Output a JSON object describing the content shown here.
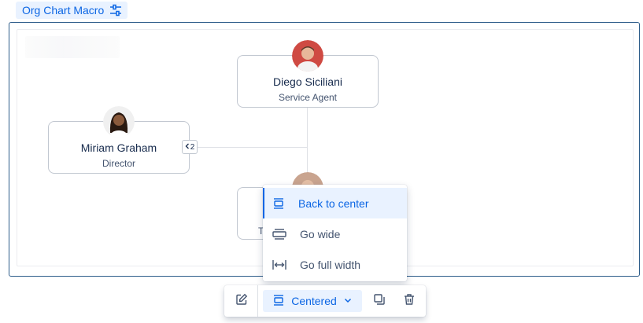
{
  "macro": {
    "label": "Org Chart Macro",
    "icon": "settings-sliders-icon"
  },
  "org_chart": {
    "nodes": [
      {
        "id": "diego",
        "name": "Diego Siciliani",
        "role": "Service Agent",
        "avatar_color": "#d9534f"
      },
      {
        "id": "miriam",
        "name": "Miriam Graham",
        "role": "Director",
        "reports_count": "2"
      },
      {
        "id": "hidden",
        "role_partial": "T"
      }
    ]
  },
  "layout_menu": {
    "items": [
      {
        "label": "Back to center",
        "icon": "back-to-center-icon",
        "selected": true
      },
      {
        "label": "Go wide",
        "icon": "go-wide-icon",
        "selected": false
      },
      {
        "label": "Go full width",
        "icon": "go-full-width-icon",
        "selected": false
      }
    ]
  },
  "toolbar": {
    "edit_icon": "edit-icon",
    "layout_label": "Centered",
    "copy_icon": "copy-icon",
    "delete_icon": "trash-icon"
  },
  "colors": {
    "accent": "#0c66e4",
    "selected_bg": "#e9f2ff",
    "frame_border": "#2e5d8a"
  }
}
